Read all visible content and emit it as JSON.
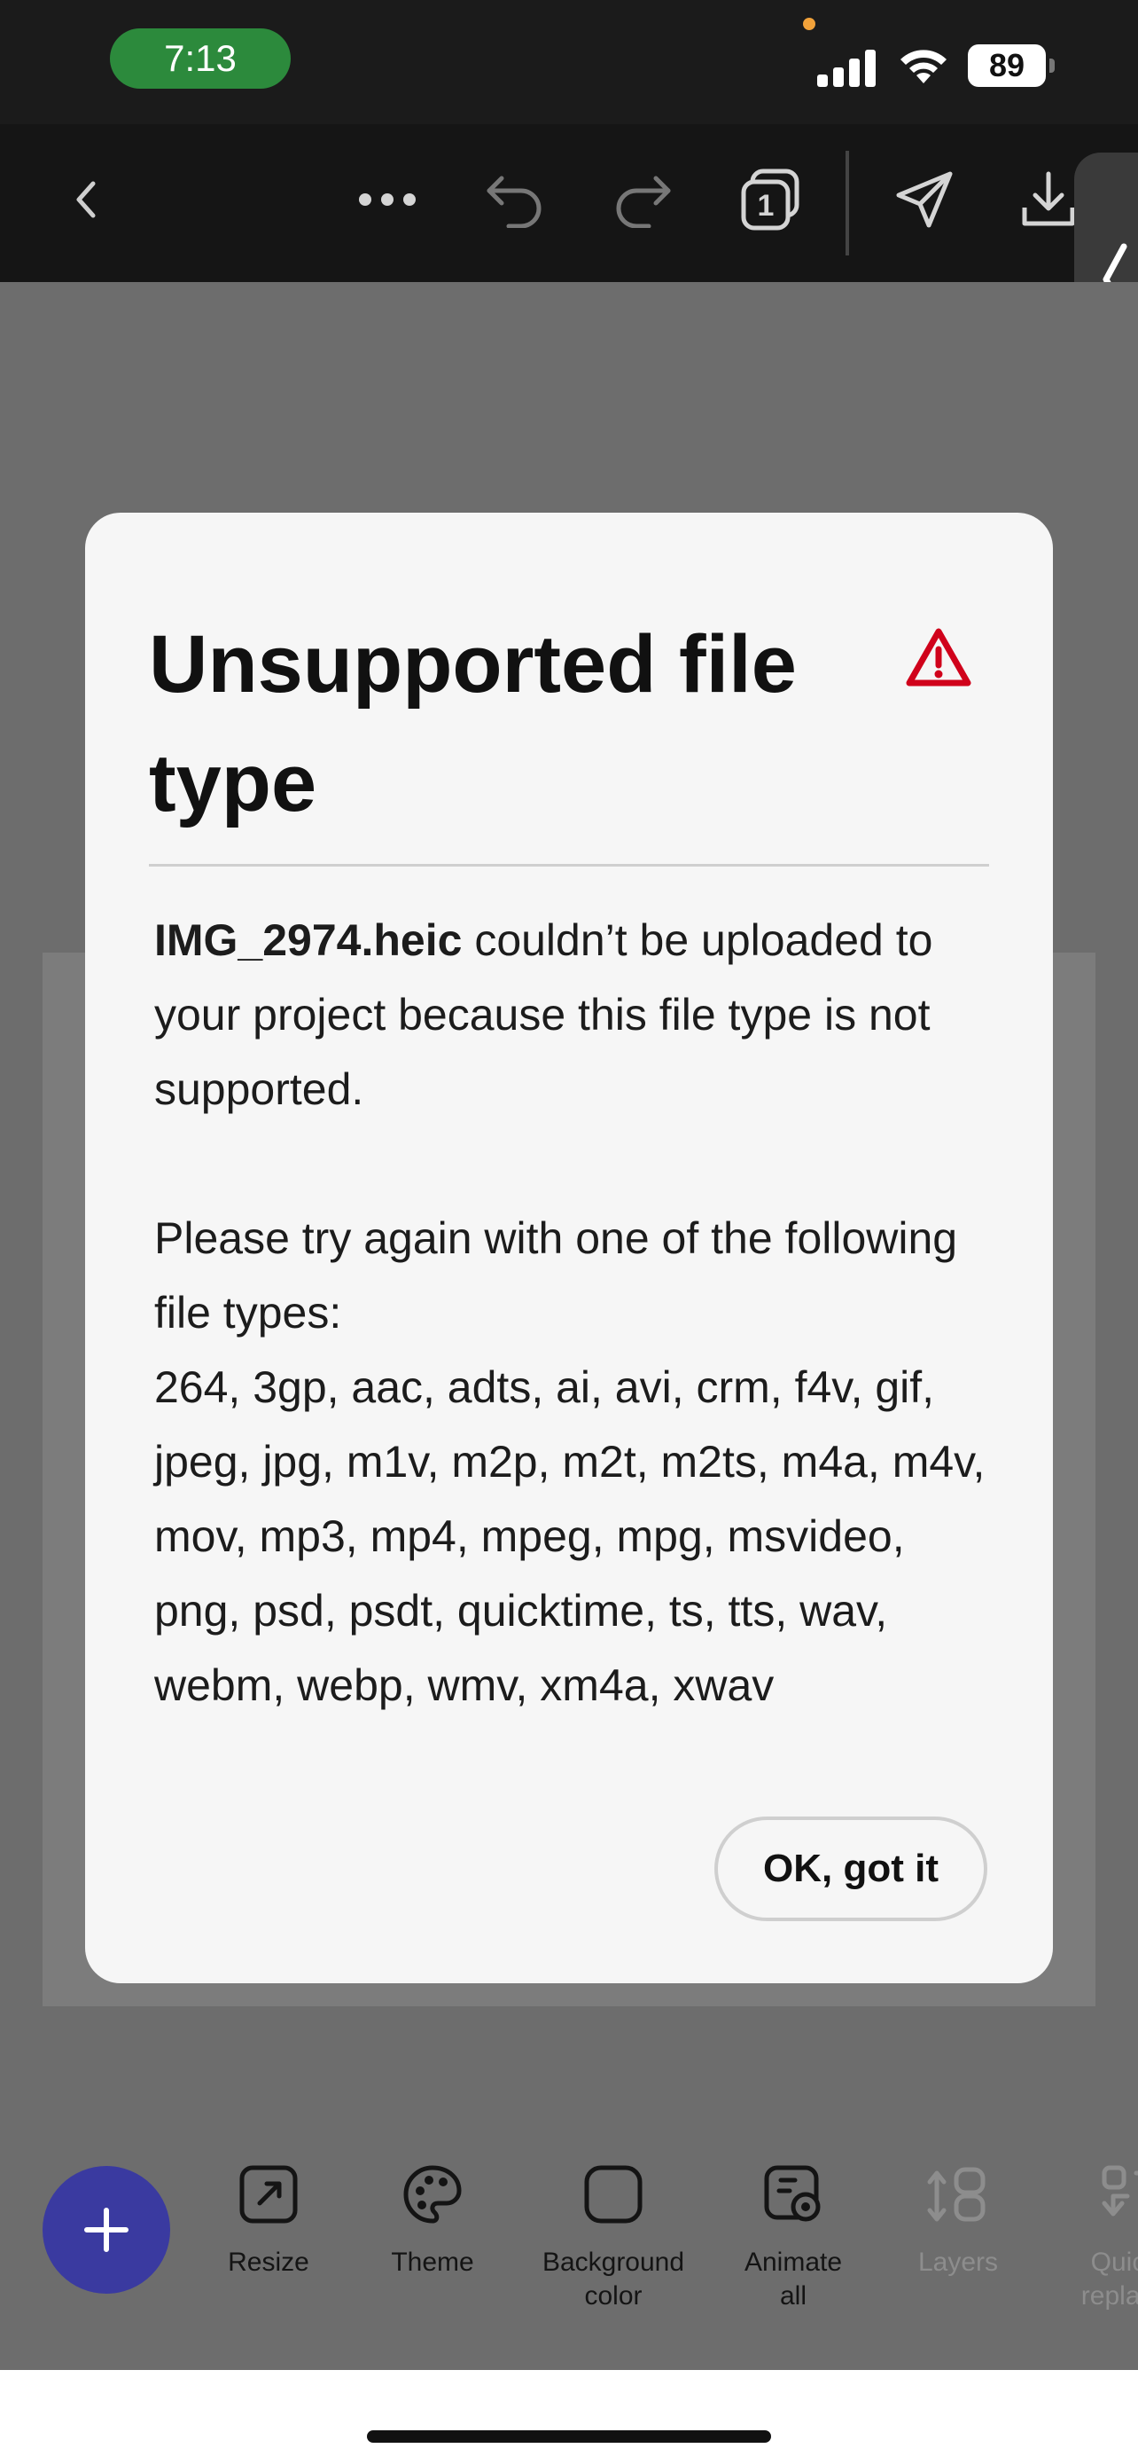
{
  "status_bar": {
    "time": "7:13",
    "battery": "89"
  },
  "toolbar": {
    "icons": [
      "back-icon",
      "more-icon",
      "undo-icon",
      "redo-icon",
      "pages-icon",
      "share-icon",
      "download-icon"
    ],
    "pages_count": "1"
  },
  "bottom_toolbar": {
    "add_label": "+",
    "items": [
      {
        "label": "Resize",
        "icon": "resize-icon",
        "enabled": true
      },
      {
        "label": "Theme",
        "icon": "palette-icon",
        "enabled": true
      },
      {
        "label": "Background\ncolor",
        "icon": "background-color-icon",
        "enabled": true
      },
      {
        "label": "Animate\nall",
        "icon": "animate-icon",
        "enabled": true
      },
      {
        "label": "Layers",
        "icon": "layers-icon",
        "enabled": false
      },
      {
        "label": "Quick\nreplace",
        "icon": "quick-replace-icon",
        "enabled": false
      }
    ]
  },
  "dialog": {
    "title": "Unsupported file type",
    "filename": "IMG_2974.heic",
    "message_rest": " couldn’t be uploaded to your project because this file type is not supported.",
    "prompt": "Please try again with one of the following file types:",
    "file_types": "264, 3gp, aac, adts, ai, avi, crm, f4v, gif, jpeg, jpg, m1v, m2p, m2t, m2ts, m4a, m4v, mov, mp3, mp4, mpeg, mpg, msvideo, png, psd, psdt, quicktime, ts, tts, wav, webm, webp, wmv, xm4a, xwav",
    "ok_label": "OK, got it"
  },
  "colors": {
    "fab": "#3a3aa0",
    "alert": "#d0021b",
    "time_pill": "#2c8a3c"
  }
}
